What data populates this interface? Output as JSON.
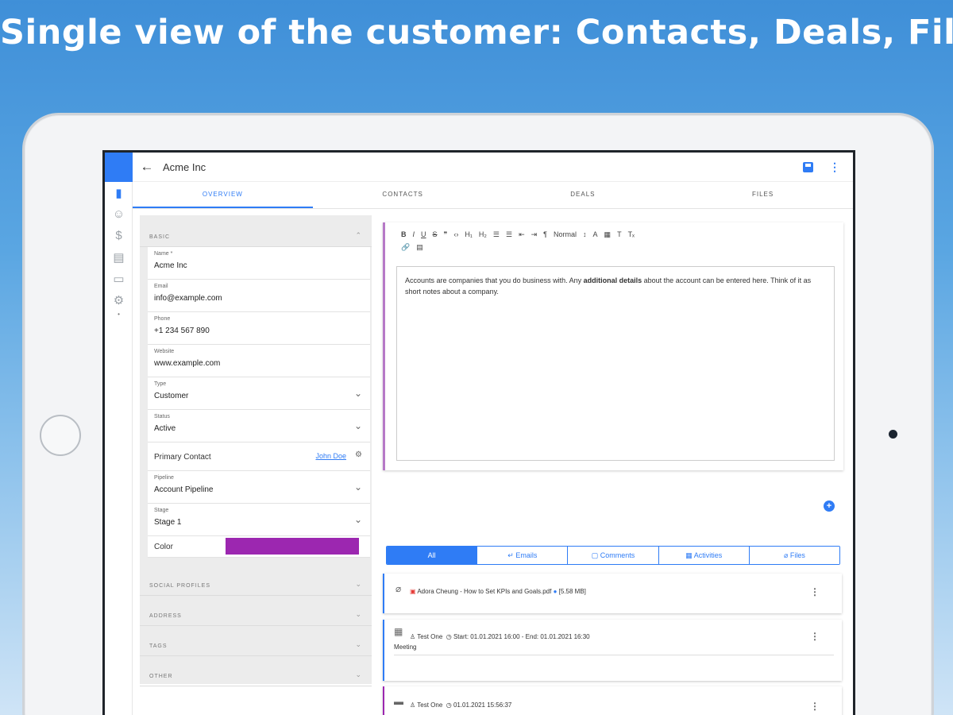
{
  "headline": "Single view of the customer: Contacts, Deals, Files",
  "appbar": {
    "title": "Acme Inc"
  },
  "tabs": [
    "OVERVIEW",
    "CONTACTS",
    "DEALS",
    "FILES"
  ],
  "form": {
    "basic_header": "BASIC",
    "fields": {
      "name": {
        "label": "Name *",
        "value": "Acme Inc"
      },
      "email": {
        "label": "Email",
        "value": "info@example.com"
      },
      "phone": {
        "label": "Phone",
        "value": "+1 234 567 890"
      },
      "website": {
        "label": "Website",
        "value": "www.example.com"
      },
      "type": {
        "label": "Type",
        "value": "Customer"
      },
      "status": {
        "label": "Status",
        "value": "Active"
      },
      "pipeline": {
        "label": "Pipeline",
        "value": "Account Pipeline"
      },
      "stage": {
        "label": "Stage",
        "value": "Stage 1"
      }
    },
    "primary_contact": {
      "label": "Primary Contact",
      "value": "John Doe"
    },
    "color": {
      "label": "Color",
      "value": "#9c27b0"
    },
    "collapsed_sections": [
      "SOCIAL PROFILES",
      "ADDRESS",
      "TAGS",
      "OTHER"
    ]
  },
  "editor": {
    "toolbar": [
      "B",
      "I",
      "U",
      "S",
      "❞",
      "‹›",
      "H₁",
      "H₂",
      "☰",
      "☰",
      "⇤",
      "⇥",
      "¶",
      "Normal",
      "↕",
      "A",
      "▦",
      "T",
      "Tₓ",
      "🔗",
      "▤"
    ],
    "text_before": "Accounts are companies that you do business with. Any ",
    "text_bold": "additional details",
    "text_after": " about the account can be entered here. Think of it as short notes about a company."
  },
  "filters": [
    {
      "label": "All",
      "icon": ""
    },
    {
      "label": "Emails",
      "icon": "↵"
    },
    {
      "label": "Comments",
      "icon": "▢"
    },
    {
      "label": "Activities",
      "icon": "▦"
    },
    {
      "label": "Files",
      "icon": "⌀"
    }
  ],
  "activities": {
    "file": {
      "name": "Adora Cheung - How to Set KPIs and Goals.pdf",
      "size": "[5.58 MB]"
    },
    "meeting": {
      "user": "Test One",
      "time": "Start: 01.01.2021 16:00 - End: 01.01.2021 16:30",
      "type": "Meeting"
    },
    "note": {
      "user": "Test One",
      "time": "01.01.2021 15:56:37"
    }
  },
  "colors": {
    "accent": "#2f7cf5",
    "swatch": "#9c27b0",
    "editor_border": "#b679c7"
  }
}
